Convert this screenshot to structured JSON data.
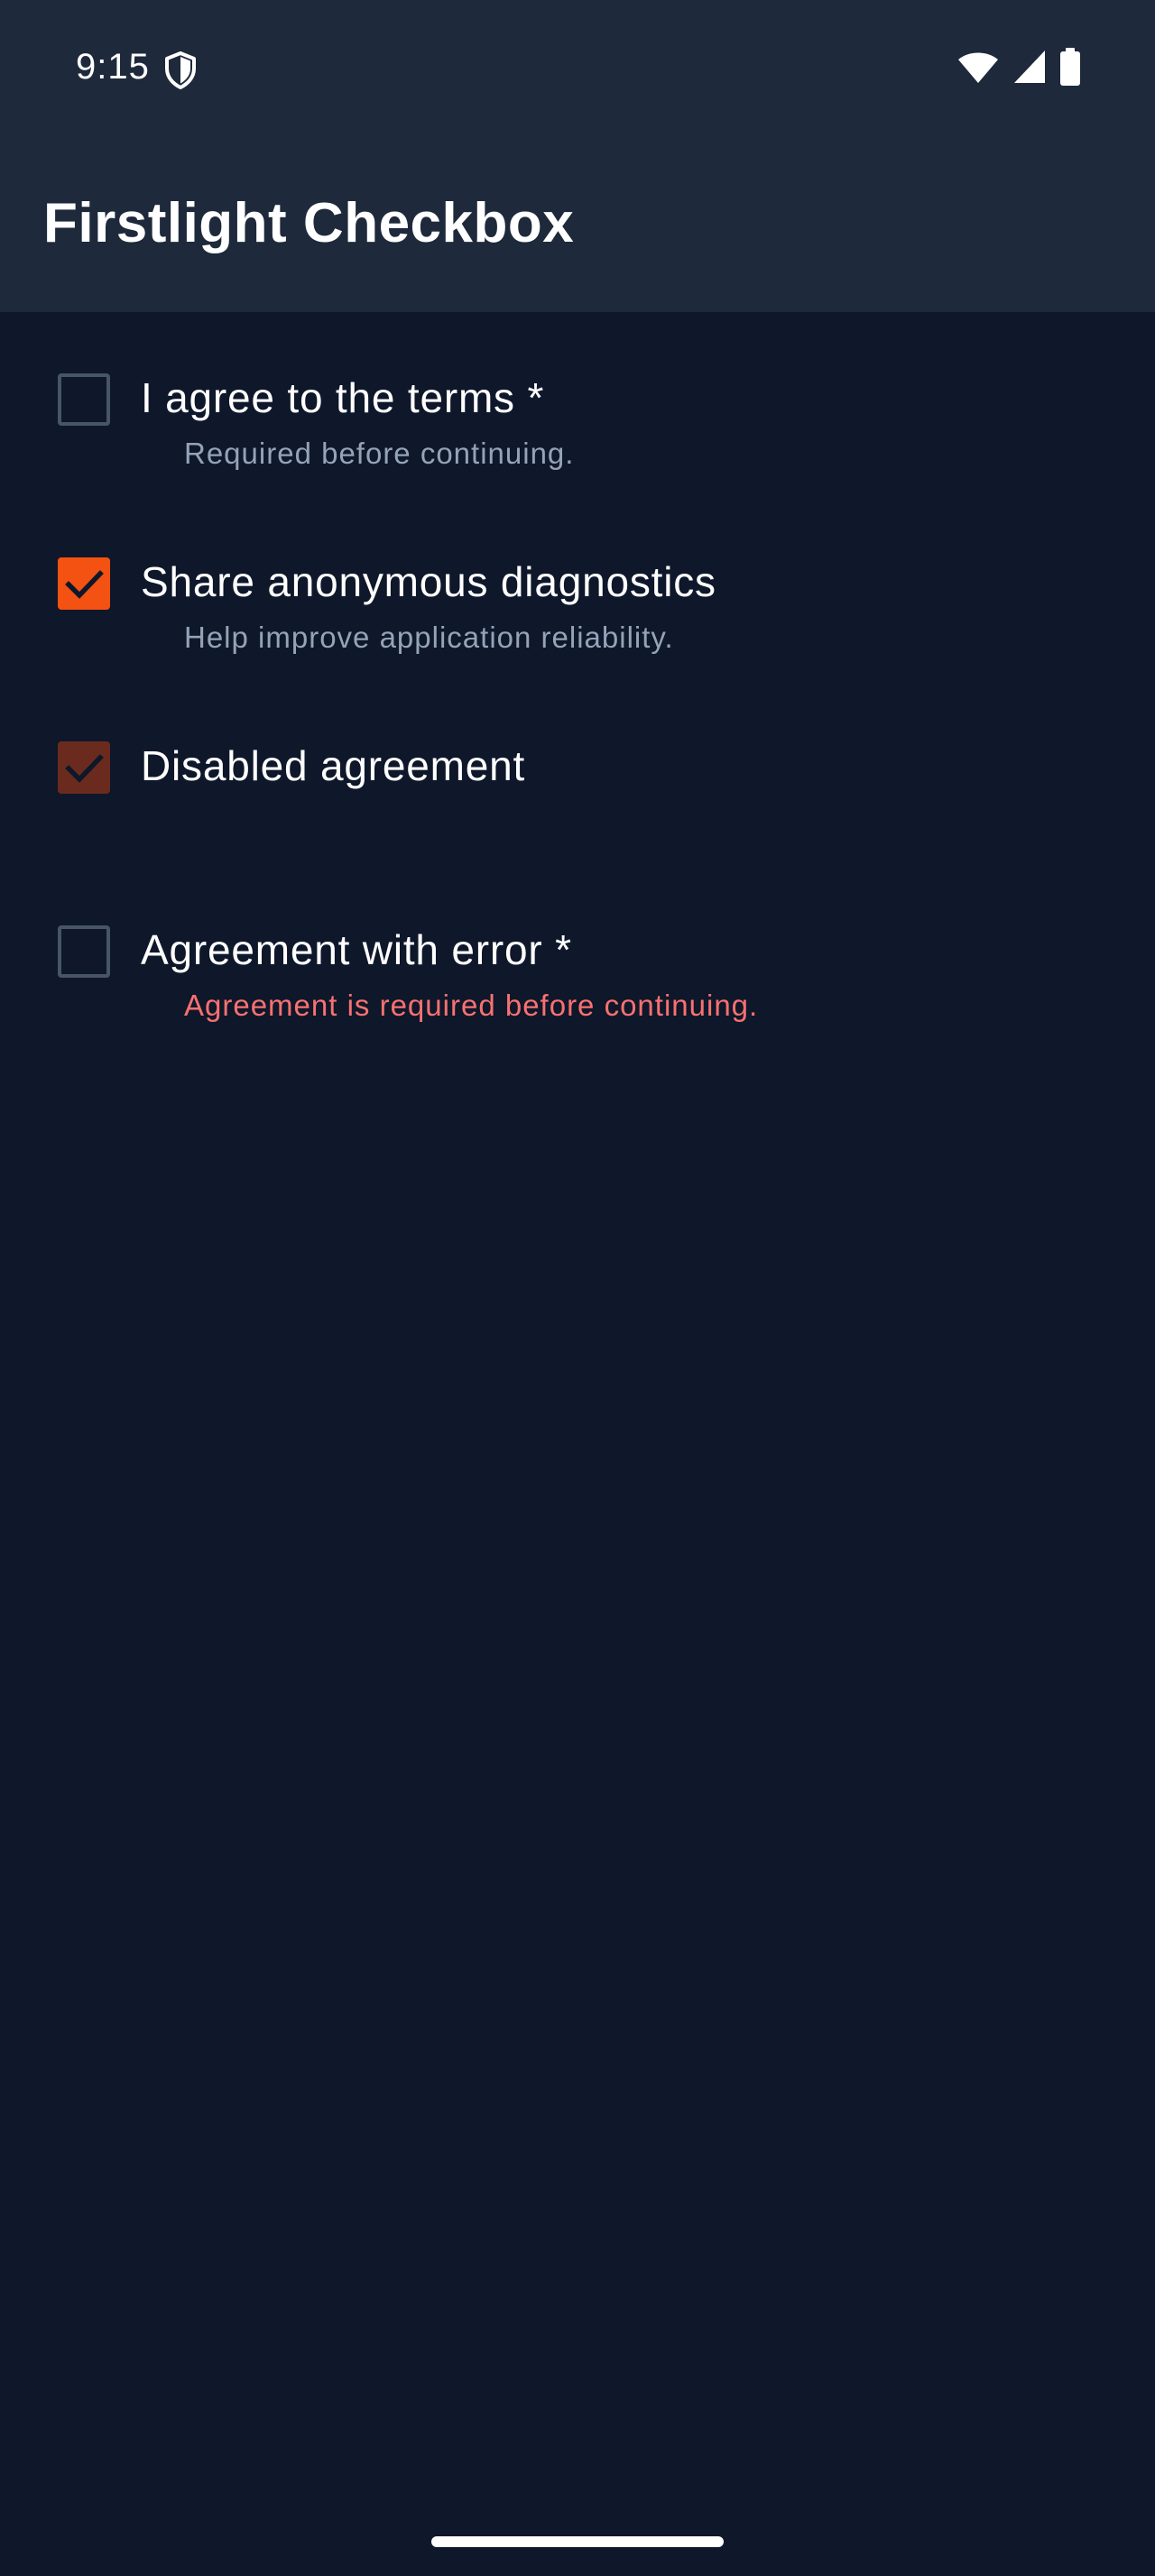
{
  "status_bar": {
    "time": "9:15",
    "icons": [
      "shield-icon",
      "wifi-icon",
      "signal-icon",
      "battery-icon"
    ]
  },
  "app_bar": {
    "title": "Firstlight Checkbox"
  },
  "checkboxes": [
    {
      "label": "I agree to the terms *",
      "helper": "Required before continuing.",
      "checked": false,
      "disabled": false,
      "error": false
    },
    {
      "label": "Share anonymous diagnostics",
      "helper": "Help improve application reliability.",
      "checked": true,
      "disabled": false,
      "error": false
    },
    {
      "label": "Disabled agreement",
      "helper": "",
      "checked": true,
      "disabled": true,
      "error": false
    },
    {
      "label": "Agreement with error *",
      "helper": "Agreement is required before continuing.",
      "checked": false,
      "disabled": false,
      "error": true
    }
  ],
  "colors": {
    "background": "#0f172a",
    "app_bar": "#1e293b",
    "accent": "#f45212",
    "disabled_accent": "#6a2b1e",
    "error": "#f87171",
    "helper_text": "#94a3b8",
    "unchecked_border": "#475569"
  }
}
